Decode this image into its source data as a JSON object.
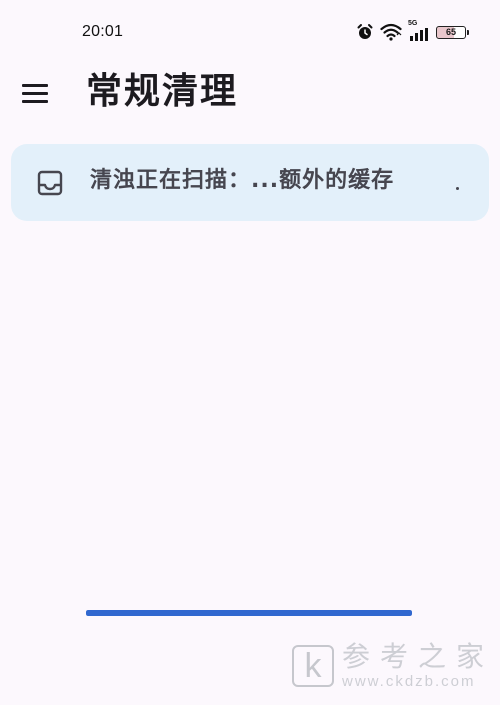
{
  "status_bar": {
    "time": "20:01",
    "network_type": "5G",
    "battery_level": "65",
    "icons": [
      "alarm-icon",
      "wifi-icon",
      "signal-icon",
      "battery-icon"
    ]
  },
  "app_bar": {
    "title": "常规清理",
    "menu_icon": "menu-icon"
  },
  "scan_card": {
    "icon": "inbox-icon",
    "text": "清浊正在扫描：...额外的缓存"
  },
  "progress": {
    "value": 1.0
  },
  "watermark": {
    "logo_letter": "k",
    "text": "参考之家",
    "url": "www.ckdzb.com"
  },
  "colors": {
    "background": "#fcf8fd",
    "card": "#e3f0fa",
    "progress": "#3168cf",
    "text": "#1d1b20"
  }
}
